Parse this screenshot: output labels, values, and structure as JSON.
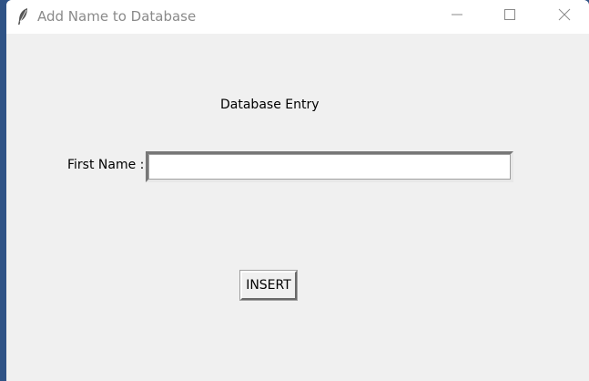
{
  "window": {
    "title": "Add Name to Database",
    "icon": "feather-icon",
    "controls": {
      "minimize_icon": "minimize-icon",
      "maximize_icon": "maximize-icon",
      "close_icon": "close-icon"
    }
  },
  "form": {
    "header": "Database Entry",
    "first_name_label": "First Name :",
    "first_name_value": "",
    "insert_label": "INSERT"
  },
  "colors": {
    "desktop": "#2f5386",
    "window_background": "#f0f0f0",
    "titlebar_background": "#ffffff",
    "title_text": "#8a8a8a"
  }
}
